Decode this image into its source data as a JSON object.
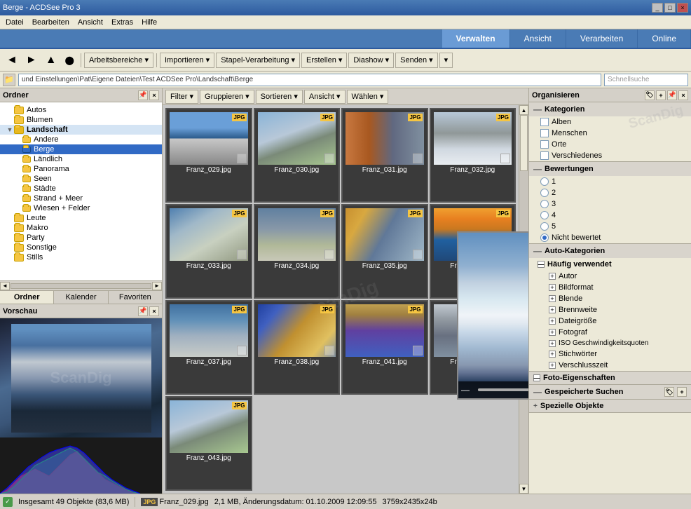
{
  "titleBar": {
    "title": "Berge - ACDSee Pro 3",
    "controls": [
      "_",
      "□",
      "×"
    ]
  },
  "menuBar": {
    "items": [
      "Datei",
      "Bearbeiten",
      "Ansicht",
      "Extras",
      "Hilfe"
    ]
  },
  "topTabs": {
    "items": [
      "Verwalten",
      "Ansicht",
      "Verarbeiten",
      "Online"
    ],
    "active": "Verwalten"
  },
  "toolbar": {
    "navButtons": [
      "◄",
      "►",
      "▲",
      "⬤"
    ],
    "dropdowns": [
      "Arbeitsbereiche ▾",
      "Importieren ▾",
      "Stapel-Verarbeitung ▾",
      "Erstellen ▾",
      "Diashow ▾",
      "Senden ▾",
      "▾"
    ]
  },
  "pathBar": {
    "path": "und Einstellungen\\Pat\\Eigene Dateien\\Test ACDSee Pro\\Landschaft\\Berge",
    "searchPlaceholder": "Schnellsuche"
  },
  "leftPanel": {
    "title": "Ordner",
    "tabs": [
      "Ordner",
      "Kalender",
      "Favoriten"
    ],
    "activeTab": "Ordner",
    "tree": [
      {
        "label": "Autos",
        "level": 1,
        "hasChildren": false
      },
      {
        "label": "Blumen",
        "level": 1,
        "hasChildren": false
      },
      {
        "label": "Landschaft",
        "level": 1,
        "hasChildren": true,
        "expanded": true
      },
      {
        "label": "Andere",
        "level": 2,
        "hasChildren": false
      },
      {
        "label": "Berge",
        "level": 2,
        "hasChildren": false,
        "selected": true
      },
      {
        "label": "Ländlich",
        "level": 2,
        "hasChildren": false
      },
      {
        "label": "Panorama",
        "level": 2,
        "hasChildren": false
      },
      {
        "label": "Seen",
        "level": 2,
        "hasChildren": false
      },
      {
        "label": "Städte",
        "level": 2,
        "hasChildren": false
      },
      {
        "label": "Strand + Meer",
        "level": 2,
        "hasChildren": false
      },
      {
        "label": "Wiesen + Felder",
        "level": 2,
        "hasChildren": false
      },
      {
        "label": "Leute",
        "level": 1,
        "hasChildren": false
      },
      {
        "label": "Makro",
        "level": 1,
        "hasChildren": false
      },
      {
        "label": "Party",
        "level": 1,
        "hasChildren": false
      },
      {
        "label": "Sonstige",
        "level": 1,
        "hasChildren": false
      },
      {
        "label": "Stills",
        "level": 1,
        "hasChildren": false
      }
    ]
  },
  "previewPanel": {
    "title": "Vorschau"
  },
  "filterBar": {
    "items": [
      "Filter ▾",
      "Gruppieren ▾",
      "Sortieren ▾",
      "Ansicht ▾",
      "Wählen ▾"
    ]
  },
  "imageGrid": {
    "images": [
      {
        "name": "Franz_029.jpg",
        "thumb": "mountain1",
        "badge": "JPG"
      },
      {
        "name": "Franz_030.jpg",
        "thumb": "mountain2",
        "badge": "JPG"
      },
      {
        "name": "Franz_031.jpg",
        "thumb": "mountain3",
        "badge": "JPG"
      },
      {
        "name": "Franz_032.jpg",
        "thumb": "mountain4",
        "badge": "JPG"
      },
      {
        "name": "Franz_033.jpg",
        "thumb": "mountain5",
        "badge": "JPG"
      },
      {
        "name": "Franz_034.jpg",
        "thumb": "mountain6",
        "badge": "JPG"
      },
      {
        "name": "Franz_035.jpg",
        "thumb": "mountain7",
        "badge": "JPG"
      },
      {
        "name": "Franz_036.jpg",
        "thumb": "mountain8",
        "badge": "JPG"
      },
      {
        "name": "Franz_037.jpg",
        "thumb": "mountain9",
        "badge": "JPG"
      },
      {
        "name": "Franz_038.jpg",
        "thumb": "mountain10",
        "badge": "JPG"
      },
      {
        "name": "Franz_041.jpg",
        "thumb": "mountain11",
        "badge": "JPG"
      },
      {
        "name": "Franz_042.jpg",
        "thumb": "mountain12",
        "badge": "JPG"
      }
    ]
  },
  "rightPanel": {
    "title": "Organisieren",
    "kategorien": {
      "title": "Kategorien",
      "items": [
        "Alben",
        "Menschen",
        "Orte",
        "Verschiedenes"
      ]
    },
    "bewertungen": {
      "title": "Bewertungen",
      "items": [
        "1",
        "2",
        "3",
        "4",
        "5",
        "Nicht bewertet"
      ],
      "checked": "Nicht bewertet"
    },
    "autoKategorien": {
      "title": "Auto-Kategorien"
    },
    "haeufigVerwendet": {
      "title": "Häufig verwendet",
      "items": [
        "Autor",
        "Bildformat",
        "Blende",
        "Brennweite",
        "Dateigröße",
        "Fotograf",
        "ISO Geschwindigkeitsquoten",
        "Stichwörter",
        "Verschlusszeit"
      ]
    },
    "fotoEigenschaften": {
      "title": "Foto-Eigenschaften"
    },
    "gespeicherteSuchen": {
      "title": "Gespeicherte Suchen"
    },
    "spezielleObjekte": {
      "title": "Spezielle Objekte"
    }
  },
  "statusBar": {
    "total": "Insgesamt 49 Objekte  (83,6 MB)",
    "selected": "Franz_029.jpg",
    "size": "2,1 MB, Änderungsdatum: 01.10.2009 12:09:55",
    "dimensions": "3759x2435x24b"
  },
  "popup": {
    "visible": true,
    "controls": [
      "—",
      "+"
    ]
  }
}
